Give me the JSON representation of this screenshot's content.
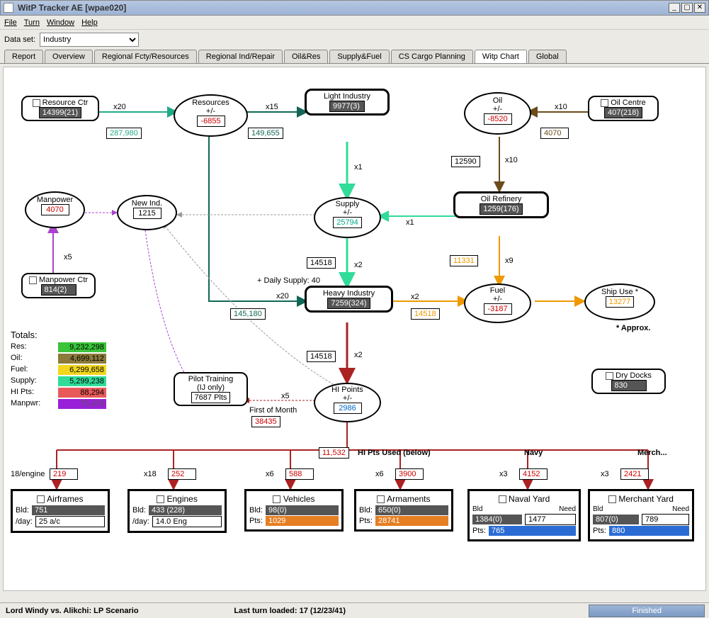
{
  "window": {
    "title": "WitP Tracker AE  [wpae020]"
  },
  "menu": {
    "file": "File",
    "turn": "Turn",
    "window": "Window",
    "help": "Help"
  },
  "dataset": {
    "label": "Data set:",
    "value": "Industry"
  },
  "tabs": {
    "report": "Report",
    "overview": "Overview",
    "regional_fcty": "Regional Fcty/Resources",
    "regional_ind": "Regional Ind/Repair",
    "oilres": "Oil&Res",
    "supplyfuel": "Supply&Fuel",
    "cscargo": "CS Cargo Planning",
    "witpchart": "Witp Chart",
    "global": "Global"
  },
  "nodes": {
    "resource_ctr": {
      "title": "Resource Ctr",
      "value": "14399(21)"
    },
    "resources": {
      "title": "Resources",
      "sub": "+/-",
      "value": "-6855"
    },
    "light_industry": {
      "title": "Light Industry",
      "value": "9977(3)"
    },
    "oil": {
      "title": "Oil",
      "sub": "+/-",
      "value": "-8520"
    },
    "oil_centre": {
      "title": "Oil Centre",
      "value": "407(218)"
    },
    "manpower": {
      "title": "Manpower",
      "value": "4070"
    },
    "new_ind": {
      "title": "New Ind.",
      "value": "1215"
    },
    "supply": {
      "title": "Supply",
      "sub": "+/-",
      "value": "25794"
    },
    "oil_refinery": {
      "title": "Oil Refinery",
      "value": "1259(176)"
    },
    "manpower_ctr": {
      "title": "Manpower Ctr",
      "value": "814(2)"
    },
    "heavy_industry": {
      "title": "Heavy Industry",
      "value": "7259(324)"
    },
    "fuel": {
      "title": "Fuel",
      "sub": "+/-",
      "value": "-3187"
    },
    "ship_use": {
      "title": "Ship Use *",
      "value": "13277",
      "note": "* Approx."
    },
    "pilot_training": {
      "title": "Pilot Training",
      "sub": "(IJ only)",
      "value": "7687 Plts"
    },
    "hi_points": {
      "title": "HI Points",
      "sub": "+/-",
      "value": "2986"
    },
    "dry_docks": {
      "title": "Dry Docks",
      "value": "830"
    }
  },
  "edges": {
    "rc_res_mult": "x20",
    "rc_res_val": "287,980",
    "res_li_mult": "x15",
    "res_li_val": "149,655",
    "oc_oil_mult": "x10",
    "oc_oil_val": "4070",
    "oil_ref_mult": "x10",
    "oil_ref_val": "12590",
    "li_supply_mult": "x1",
    "ref_supply_mult": "x1",
    "supply_hi_mult": "x2",
    "supply_hi_val": "14518",
    "ref_fuel_mult": "x9",
    "ref_fuel_val": "11331",
    "res_hi_mult": "x20",
    "res_hi_val": "145,180",
    "hi_fuel_mult": "x2",
    "hi_fuel_val": "14518",
    "hi_pts_mult": "x2",
    "hi_pts_val": "14518",
    "hipts_pilot_mult": "x5",
    "first_of_month": "First of Month",
    "first_of_month_val": "38435",
    "manpower_mult": "x5",
    "daily_supply": "+ Daily Supply: 40",
    "hipts_used_title": "HI Pts Used (below)",
    "hipts_used_val": "11,532",
    "navy_label": "Navy",
    "merch_label": "Merch..."
  },
  "totals": {
    "title": "Totals:",
    "res": {
      "label": "Res:",
      "value": "9,232,298",
      "color": "#3ac43a"
    },
    "oil": {
      "label": "Oil:",
      "value": "4,699,112",
      "color": "#8b7a3a"
    },
    "fuel": {
      "label": "Fuel:",
      "value": "6,299,658",
      "color": "#f2d71c"
    },
    "supply": {
      "label": "Supply:",
      "value": "5,299,238",
      "color": "#2fdc98"
    },
    "hipts": {
      "label": "HI Pts:",
      "value": "88,294",
      "color": "#e85a5a"
    },
    "manpwr": {
      "label": "Manpwr:",
      "value": "75,478",
      "color": "#9a1fd8"
    }
  },
  "production": {
    "airframes": {
      "title": "Airframes",
      "per_engine": "18/engine",
      "used": "219",
      "bld": "751",
      "day_label": "/day:",
      "day": "25 a/c"
    },
    "engines": {
      "title": "Engines",
      "mult": "x18",
      "used": "252",
      "bld": "433 (228)",
      "day_label": "/day:",
      "day": "14.0 Eng"
    },
    "vehicles": {
      "title": "Vehicles",
      "mult": "x6",
      "used": "588",
      "bld": "98(0)",
      "pts_label": "Pts:",
      "pts": "1029"
    },
    "armaments": {
      "title": "Armaments",
      "mult": "x6",
      "used": "3900",
      "bld": "650(0)",
      "pts_label": "Pts:",
      "pts": "28741"
    },
    "naval": {
      "title": "Naval Yard",
      "mult": "x3",
      "used": "4152",
      "bld": "1384(0)",
      "need": "1477",
      "pts_label": "Pts:",
      "pts": "765"
    },
    "merchant": {
      "title": "Merchant Yard",
      "mult": "x3",
      "used": "2421",
      "bld": "807(0)",
      "need": "789",
      "pts_label": "Pts:",
      "pts": "880"
    }
  },
  "statusbar": {
    "left": "Lord Windy vs. Alikchi: LP Scenario",
    "mid": "Last turn loaded: 17 (12/23/41)",
    "button": "Finished"
  }
}
